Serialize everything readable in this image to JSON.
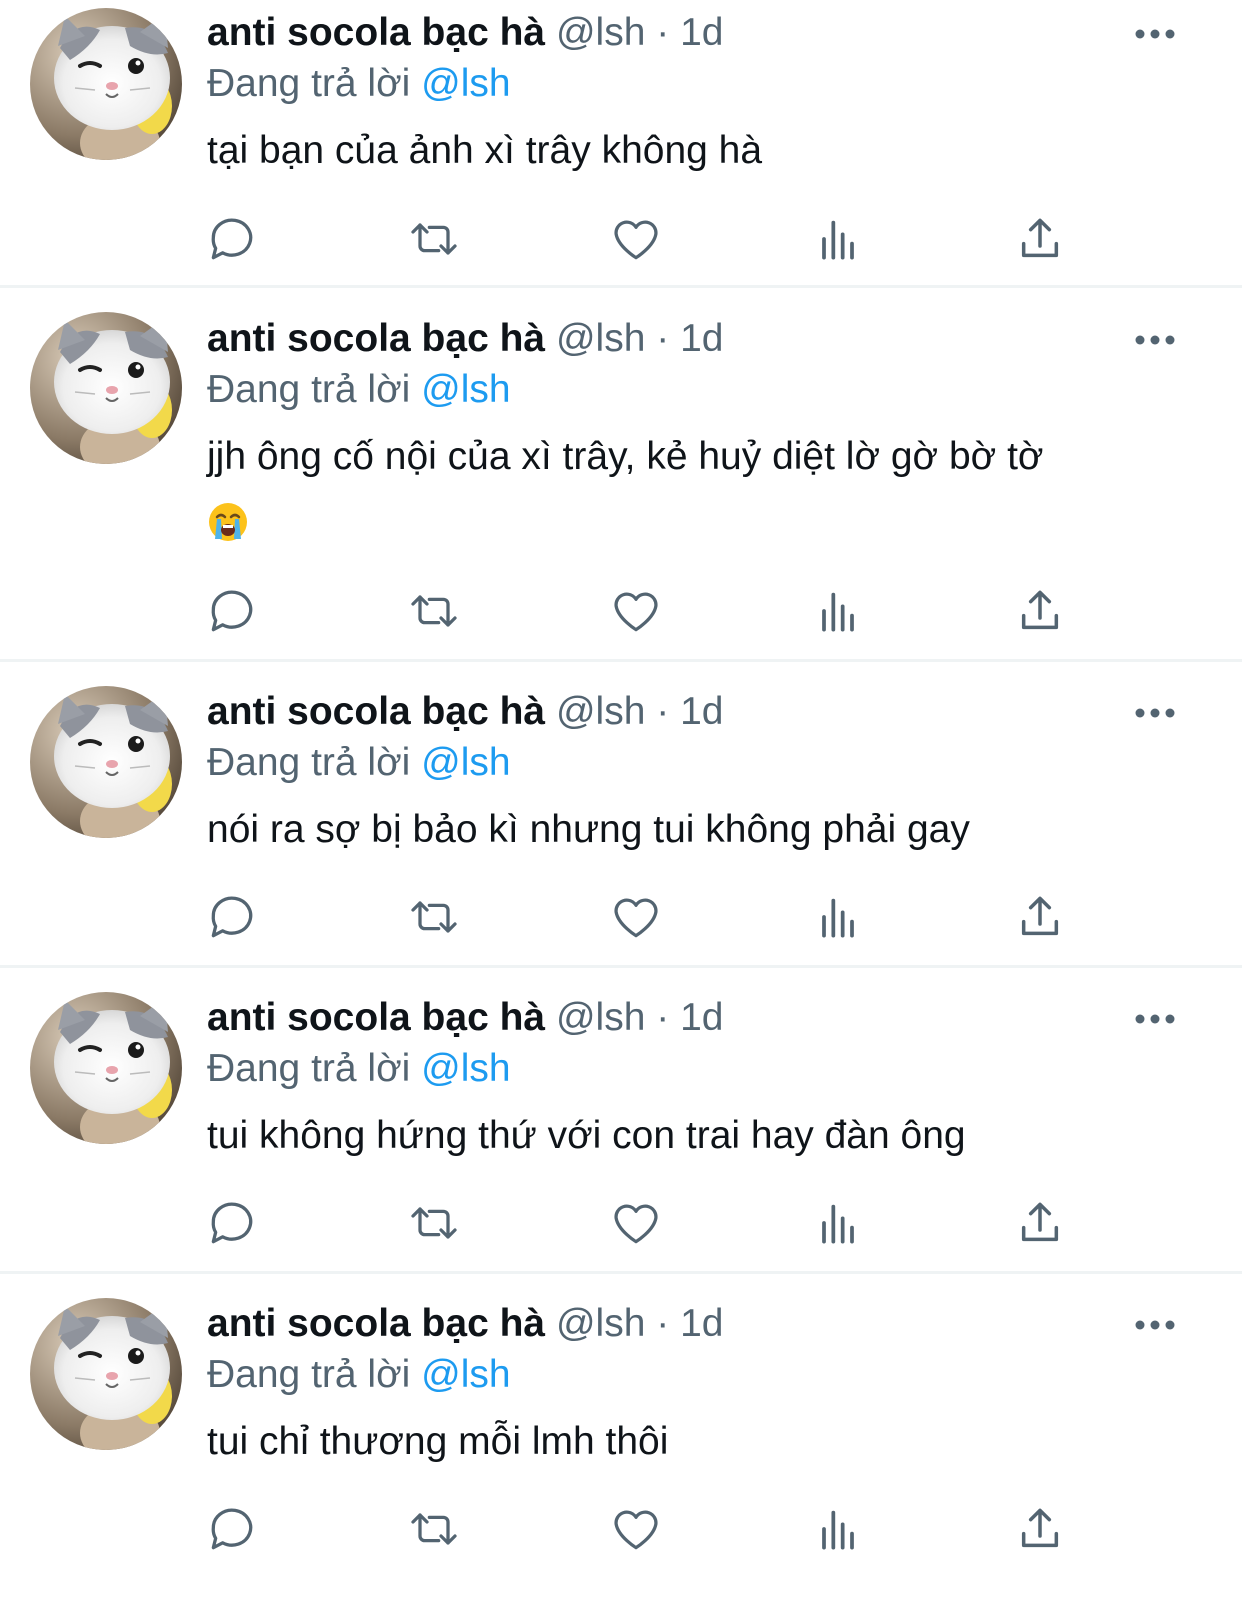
{
  "tweets": [
    {
      "name": "anti socola bạc hà",
      "handle": "@lsh",
      "separator": "·",
      "time": "1d",
      "reply_prefix": "Đang trả lời",
      "reply_to": "@lsh",
      "text": "tại bạn của ảnh xì trây không hà"
    },
    {
      "name": "anti socola bạc hà",
      "handle": "@lsh",
      "separator": "·",
      "time": "1d",
      "reply_prefix": "Đang trả lời",
      "reply_to": "@lsh",
      "text": "jjh ông cố nội của xì trây, kẻ huỷ diệt lờ gờ bờ tờ",
      "emoji": "loudly-crying-face"
    },
    {
      "name": "anti socola bạc hà",
      "handle": "@lsh",
      "separator": "·",
      "time": "1d",
      "reply_prefix": "Đang trả lời",
      "reply_to": "@lsh",
      "text": "nói ra sợ bị bảo kì nhưng tui không phải gay"
    },
    {
      "name": "anti socola bạc hà",
      "handle": "@lsh",
      "separator": "·",
      "time": "1d",
      "reply_prefix": "Đang trả lời",
      "reply_to": "@lsh",
      "text": "tui không hứng thứ với con trai hay đàn ông"
    },
    {
      "name": "anti socola bạc hà",
      "handle": "@lsh",
      "separator": "·",
      "time": "1d",
      "reply_prefix": "Đang trả lời",
      "reply_to": "@lsh",
      "text": "tui chỉ thương mỗi lmh thôi"
    }
  ],
  "icons": {
    "avatar": "cat-avatar",
    "more": "more-icon",
    "reply": "reply-icon",
    "retweet": "retweet-icon",
    "like": "like-icon",
    "views": "views-icon",
    "share": "share-icon"
  },
  "colors": {
    "text": "#0f1419",
    "muted": "#536471",
    "mention": "#1d9bf0",
    "divider": "#eff3f4"
  }
}
